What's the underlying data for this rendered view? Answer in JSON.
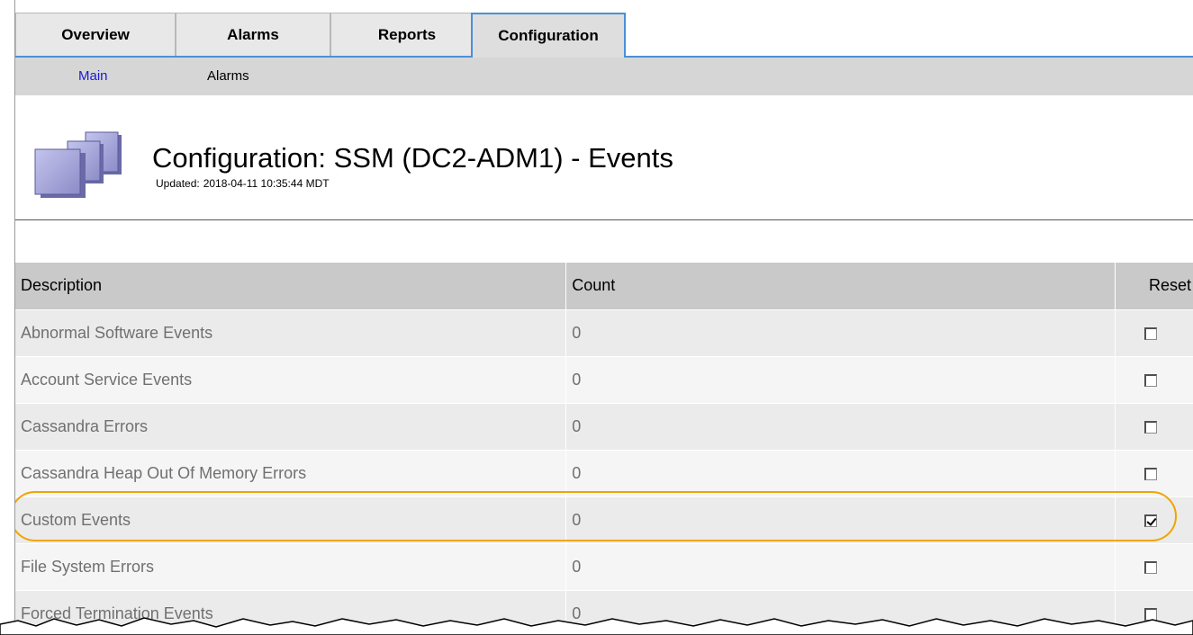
{
  "tabs": [
    {
      "label": "Overview",
      "active": false
    },
    {
      "label": "Alarms",
      "active": false
    },
    {
      "label": "Reports",
      "active": false
    },
    {
      "label": "Configuration",
      "active": true
    }
  ],
  "subnav": [
    {
      "label": "Main",
      "active": true
    },
    {
      "label": "Alarms",
      "active": false
    }
  ],
  "header": {
    "icon": "stacked-pages-icon",
    "title": "Configuration: SSM (DC2-ADM1) - Events",
    "updated_label": "Updated:",
    "updated_value": "2018-04-11 10:35:44 MDT"
  },
  "table": {
    "columns": [
      "Description",
      "Count",
      "Reset"
    ],
    "rows": [
      {
        "description": "Abnormal Software Events",
        "count": "0",
        "reset": false
      },
      {
        "description": "Account Service Events",
        "count": "0",
        "reset": false
      },
      {
        "description": "Cassandra Errors",
        "count": "0",
        "reset": false
      },
      {
        "description": "Cassandra Heap Out Of Memory Errors",
        "count": "0",
        "reset": false
      },
      {
        "description": "Custom Events",
        "count": "0",
        "reset": true,
        "highlighted": true
      },
      {
        "description": "File System Errors",
        "count": "0",
        "reset": false
      },
      {
        "description": "Forced Termination Events",
        "count": "0",
        "reset": false
      }
    ]
  },
  "colors": {
    "tab_active_border": "#4a90d9",
    "subnav_active_link": "#1a1ad4",
    "highlight_ring": "#f0a500",
    "header_row_bg": "#c9c9c9"
  }
}
